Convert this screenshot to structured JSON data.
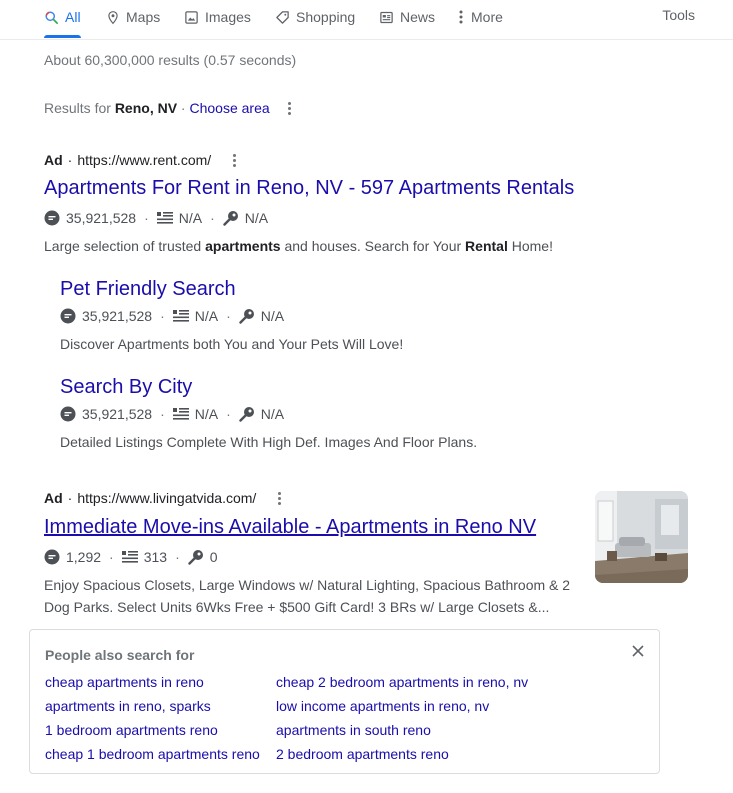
{
  "tabs": [
    {
      "label": "All",
      "icon": "search-icon"
    },
    {
      "label": "Maps",
      "icon": "map-pin-icon"
    },
    {
      "label": "Images",
      "icon": "image-icon"
    },
    {
      "label": "Shopping",
      "icon": "tag-icon"
    },
    {
      "label": "News",
      "icon": "news-icon"
    },
    {
      "label": "More",
      "icon": "more-vert-icon"
    }
  ],
  "tools_label": "Tools",
  "stats": "About 60,300,000 results (0.57 seconds)",
  "location": {
    "prefix": "Results for ",
    "place": "Reno, NV",
    "separator": " · ",
    "choose": "Choose area"
  },
  "ad1": {
    "ad_label": "Ad",
    "dot": "·",
    "url": "https://www.rent.com/",
    "title": "Apartments For Rent in Reno, NV - 597 Apartments Rentals",
    "meta": {
      "count": "35,921,528",
      "listing": "N/A",
      "key": "N/A"
    },
    "desc": {
      "p1": "Large selection of trusted ",
      "b1": "apartments",
      "p2": " and houses. Search for Your ",
      "b2": "Rental",
      "p3": " Home!"
    },
    "sitelinks": [
      {
        "title": "Pet Friendly Search",
        "count": "35,921,528",
        "listing": "N/A",
        "key": "N/A",
        "desc": "Discover Apartments both You and Your Pets Will Love!"
      },
      {
        "title": "Search By City",
        "count": "35,921,528",
        "listing": "N/A",
        "key": "N/A",
        "desc": "Detailed Listings Complete With High Def. Images And Floor Plans."
      }
    ]
  },
  "ad2": {
    "ad_label": "Ad",
    "dot": "·",
    "url": "https://www.livingatvida.com/",
    "title": "Immediate Move-ins Available - Apartments in Reno NV",
    "meta": {
      "count": "1,292",
      "listing": "313",
      "key": "0"
    },
    "desc_line1": "Enjoy Spacious Closets, Large Windows w/ Natural Lighting, Spacious Bathroom & 2",
    "desc_line2": "Dog Parks. Select Units 6Wks Free + $500 Gift Card! 3 BRs w/ Large Closets &..."
  },
  "people_also_search": {
    "title": "People also search for",
    "left": [
      "cheap apartments in reno",
      "apartments in reno, sparks",
      "1 bedroom apartments reno",
      "cheap 1 bedroom apartments reno"
    ],
    "right": [
      "cheap 2 bedroom apartments in reno, nv",
      "low income apartments in reno, nv",
      "apartments in south reno",
      "2 bedroom apartments reno"
    ]
  },
  "colors": {
    "link": "#1a0dab",
    "accent": "#1a73e8",
    "text": "#4d5156",
    "muted": "#70757a"
  }
}
